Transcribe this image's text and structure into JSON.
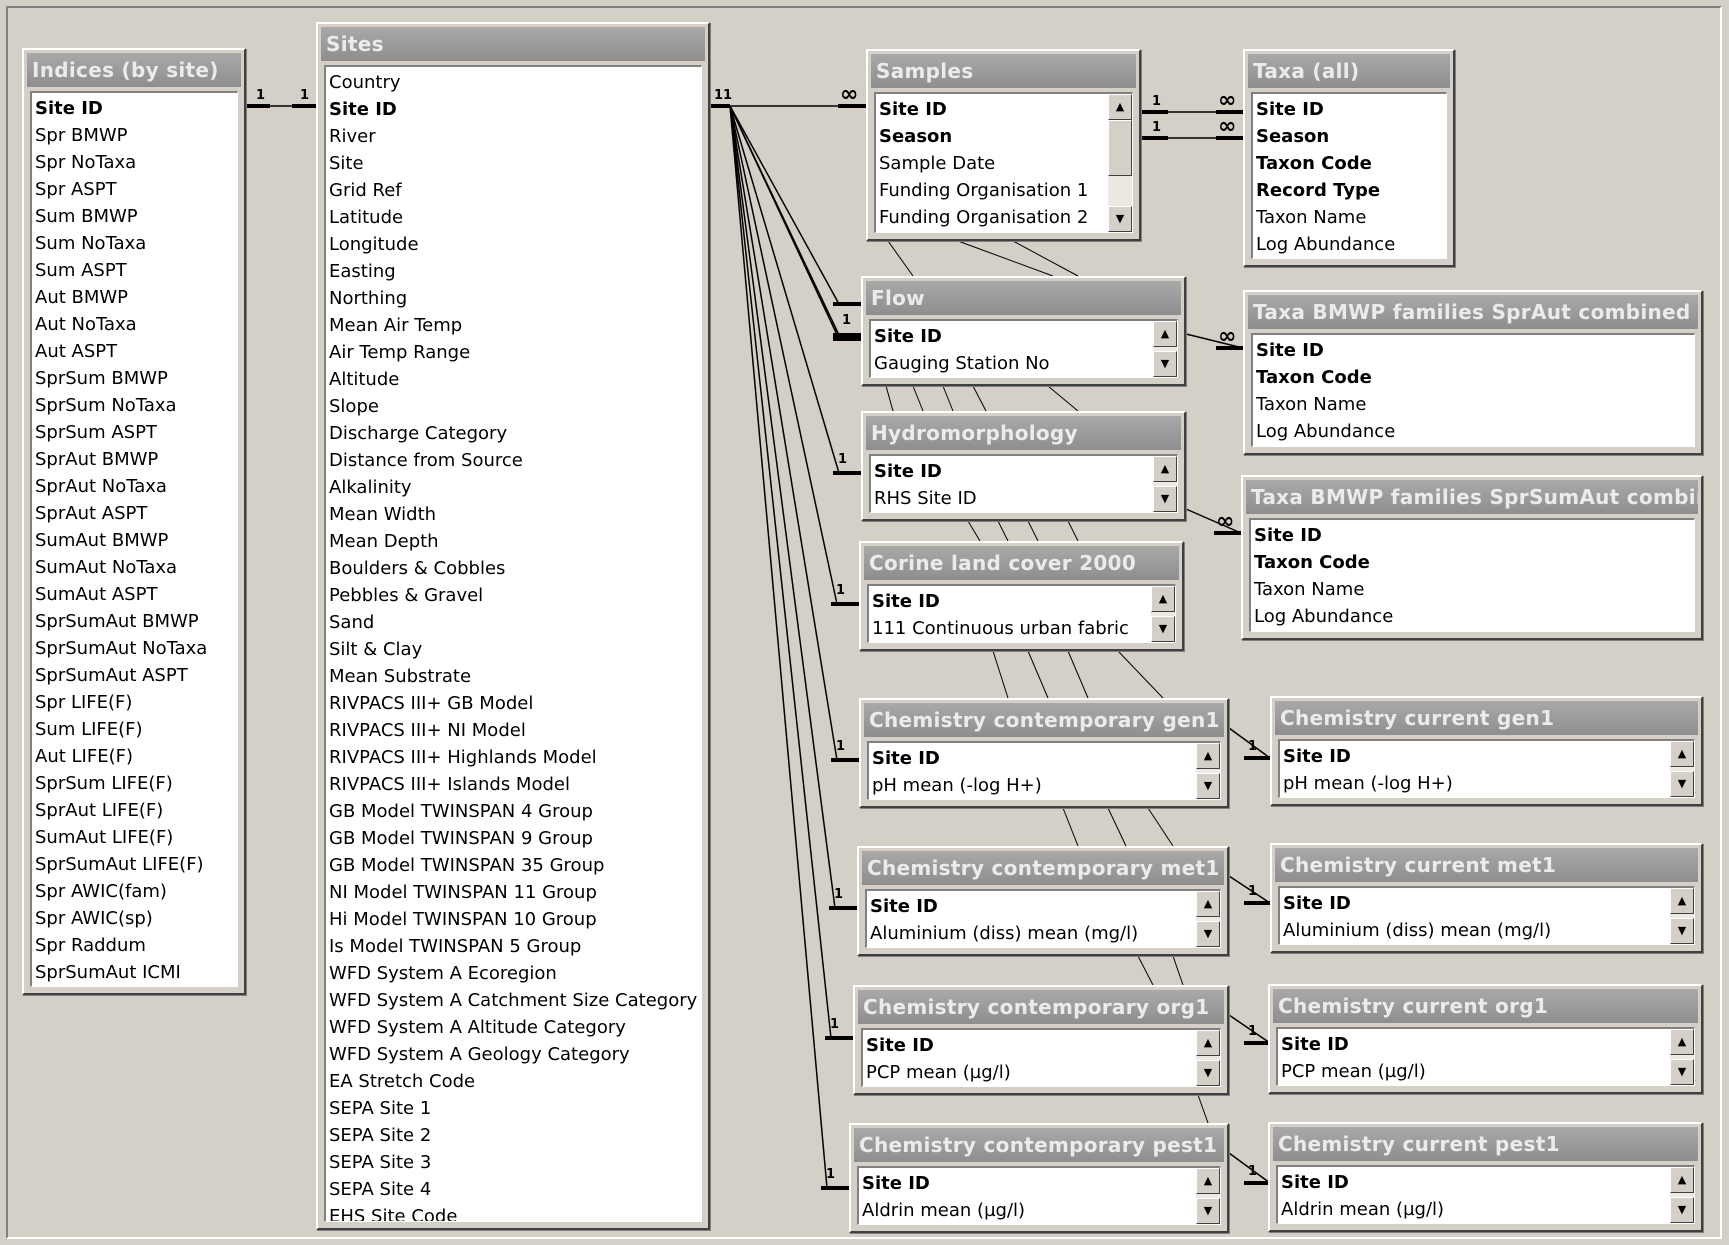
{
  "tables": {
    "indices": {
      "title": "Indices (by site)",
      "fields": [
        "Site ID",
        "Spr BMWP",
        "Spr NoTaxa",
        "Spr ASPT",
        "Sum BMWP",
        "Sum NoTaxa",
        "Sum ASPT",
        "Aut BMWP",
        "Aut NoTaxa",
        "Aut ASPT",
        "SprSum BMWP",
        "SprSum NoTaxa",
        "SprSum ASPT",
        "SprAut BMWP",
        "SprAut NoTaxa",
        "SprAut ASPT",
        "SumAut BMWP",
        "SumAut NoTaxa",
        "SumAut ASPT",
        "SprSumAut BMWP",
        "SprSumAut NoTaxa",
        "SprSumAut ASPT",
        "Spr LIFE(F)",
        "Sum LIFE(F)",
        "Aut LIFE(F)",
        "SprSum LIFE(F)",
        "SprAut LIFE(F)",
        "SumAut LIFE(F)",
        "SprSumAut LIFE(F)",
        "Spr AWIC(fam)",
        "Spr AWIC(sp)",
        "Spr Raddum",
        "SprSumAut ICMI"
      ],
      "key_count": 1
    },
    "sites": {
      "title": "Sites",
      "fields": [
        "Country",
        "Site ID",
        "River",
        "Site",
        "Grid Ref",
        "Latitude",
        "Longitude",
        "Easting",
        "Northing",
        "Mean Air Temp",
        "Air Temp Range",
        "Altitude",
        "Slope",
        "Discharge Category",
        "Distance from Source",
        "Alkalinity",
        "Mean Width",
        "Mean Depth",
        "Boulders & Cobbles",
        "Pebbles & Gravel",
        "Sand",
        "Silt & Clay",
        "Mean Substrate",
        "RIVPACS III+ GB Model",
        "RIVPACS III+ NI Model",
        "RIVPACS III+ Highlands Model",
        "RIVPACS III+ Islands Model",
        "GB Model TWINSPAN 4 Group",
        "GB Model TWINSPAN 9 Group",
        "GB Model TWINSPAN 35 Group",
        "NI Model TWINSPAN 11 Group",
        "Hi Model TWINSPAN 10 Group",
        "Is Model TWINSPAN 5 Group",
        "WFD System A Ecoregion",
        "WFD System A Catchment Size Category",
        "WFD System A Altitude Category",
        "WFD System A Geology Category",
        "EA Stretch Code",
        "SEPA Site 1",
        "SEPA Site 2",
        "SEPA Site 3",
        "SEPA Site 4",
        "EHS Site Code"
      ],
      "key_fields": [
        "Site ID"
      ]
    },
    "samples": {
      "title": "Samples",
      "fields": [
        "Site ID",
        "Season",
        "Sample Date",
        "Funding Organisation 1",
        "Funding Organisation 2"
      ],
      "key_count": 2,
      "scroll": {
        "up": "▲",
        "down": "▼"
      }
    },
    "taxa_all": {
      "title": "Taxa (all)",
      "fields": [
        "Site ID",
        "Season",
        "Taxon Code",
        "Record Type",
        "Taxon Name",
        "Log Abundance"
      ],
      "key_count": 4
    },
    "flow": {
      "title": "Flow",
      "fields": [
        "Site ID",
        "Gauging Station No"
      ],
      "key_count": 1,
      "scroll": {
        "up": "▲",
        "down": "▼"
      }
    },
    "taxa_spraut": {
      "title": "Taxa BMWP families SprAut combined",
      "fields": [
        "Site ID",
        "Taxon Code",
        "Taxon Name",
        "Log Abundance"
      ],
      "key_count": 2
    },
    "hydromorphology": {
      "title": "Hydromorphology",
      "fields": [
        "Site ID",
        "RHS Site ID"
      ],
      "key_count": 1,
      "scroll": {
        "up": "▲",
        "down": "▼"
      }
    },
    "taxa_sprsumaut": {
      "title": "Taxa BMWP families SprSumAut combined",
      "fields": [
        "Site ID",
        "Taxon Code",
        "Taxon Name",
        "Log Abundance"
      ],
      "key_count": 2
    },
    "corine": {
      "title": "Corine land cover 2000",
      "fields": [
        "Site ID",
        "111 Continuous urban fabric"
      ],
      "key_count": 1,
      "scroll": {
        "up": "▲",
        "down": "▼"
      }
    },
    "chem_cont_gen1": {
      "title": "Chemistry contemporary gen1",
      "fields": [
        "Site ID",
        "pH mean (-log H+)"
      ],
      "key_count": 1,
      "scroll": {
        "up": "▲",
        "down": "▼"
      }
    },
    "chem_curr_gen1": {
      "title": "Chemistry current gen1",
      "fields": [
        "Site ID",
        "pH mean (-log H+)"
      ],
      "key_count": 1,
      "scroll": {
        "up": "▲",
        "down": "▼"
      }
    },
    "chem_cont_met1": {
      "title": "Chemistry contemporary met1",
      "fields": [
        "Site ID",
        "Aluminium (diss) mean (mg/l)"
      ],
      "key_count": 1,
      "scroll": {
        "up": "▲",
        "down": "▼"
      }
    },
    "chem_curr_met1": {
      "title": "Chemistry current met1",
      "fields": [
        "Site ID",
        "Aluminium (diss) mean (mg/l)"
      ],
      "key_count": 1,
      "scroll": {
        "up": "▲",
        "down": "▼"
      }
    },
    "chem_cont_org1": {
      "title": "Chemistry contemporary org1",
      "fields": [
        "Site ID",
        "PCP mean (µg/l)"
      ],
      "key_count": 1,
      "scroll": {
        "up": "▲",
        "down": "▼"
      }
    },
    "chem_curr_org1": {
      "title": "Chemistry current org1",
      "fields": [
        "Site ID",
        "PCP mean (µg/l)"
      ],
      "key_count": 1,
      "scroll": {
        "up": "▲",
        "down": "▼"
      }
    },
    "chem_cont_pest1": {
      "title": "Chemistry contemporary pest1",
      "fields": [
        "Site ID",
        "Aldrin mean (µg/l)"
      ],
      "key_count": 1,
      "scroll": {
        "up": "▲",
        "down": "▼"
      }
    },
    "chem_curr_pest1": {
      "title": "Chemistry current pest1",
      "fields": [
        "Site ID",
        "Aldrin mean (µg/l)"
      ],
      "key_count": 1,
      "scroll": {
        "up": "▲",
        "down": "▼"
      }
    }
  },
  "cardinality": {
    "one": "1",
    "many": "∞",
    "sites_one_to_many": "1",
    "sites_many_side": "1"
  }
}
